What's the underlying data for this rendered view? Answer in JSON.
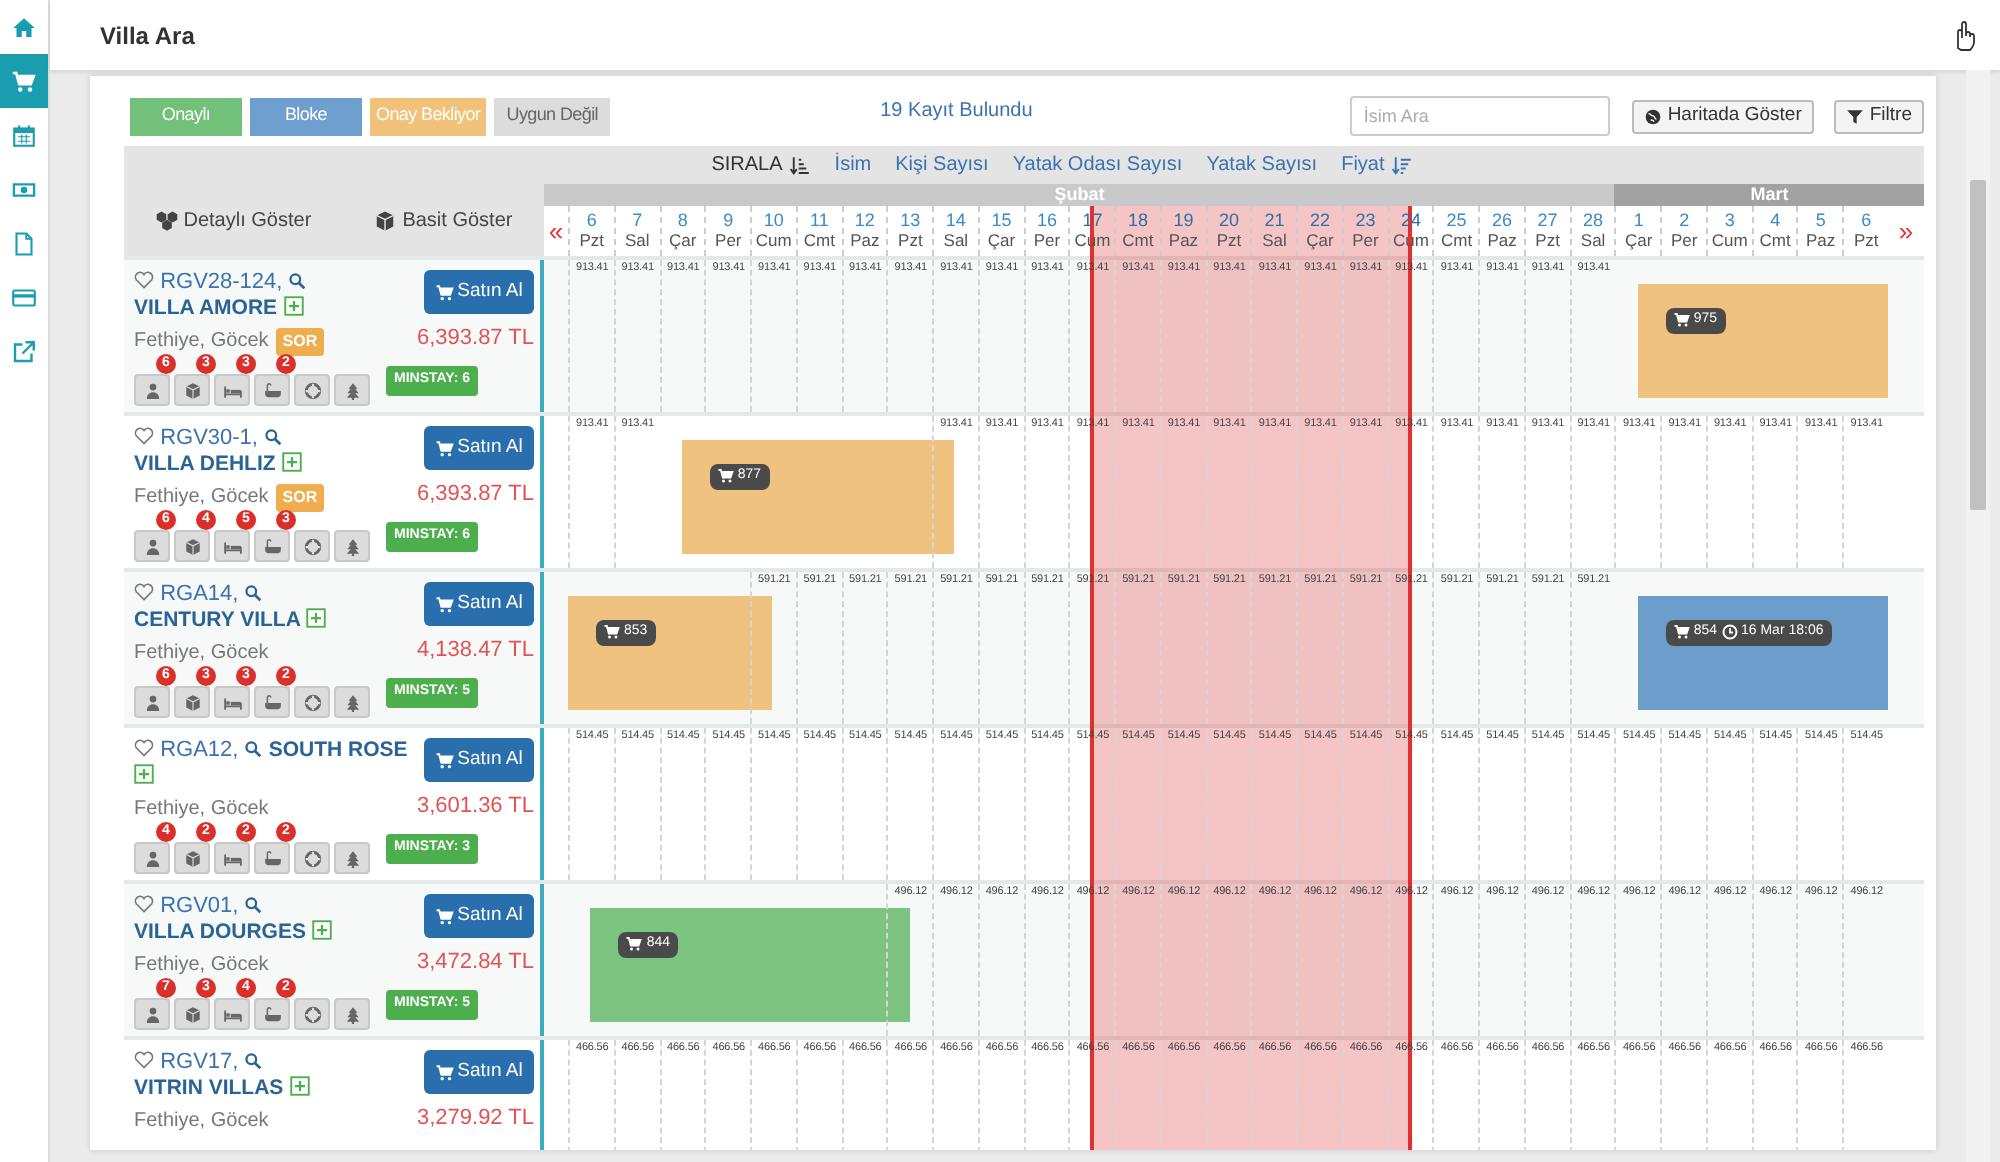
{
  "sidebar": {
    "items": [
      {
        "kind": "home",
        "selected": false
      },
      {
        "kind": "cart",
        "selected": true
      },
      {
        "kind": "calendar",
        "selected": false
      },
      {
        "kind": "money",
        "selected": false
      },
      {
        "kind": "file",
        "selected": false
      },
      {
        "kind": "card",
        "selected": false
      },
      {
        "kind": "external",
        "selected": false
      }
    ]
  },
  "page_title": "Villa Ara",
  "legend": [
    {
      "label": "Onaylı",
      "kind": "confirmed"
    },
    {
      "label": "Bloke",
      "kind": "blocked"
    },
    {
      "label": "Onay Bekliyor",
      "kind": "pending"
    },
    {
      "label": "Uygun Değil",
      "kind": "unavailable"
    }
  ],
  "result_count": "19 Kayıt Bulundu",
  "search": {
    "placeholder": "İsim Ara"
  },
  "buttons": [
    {
      "label": "Haritada Göster",
      "kind": "map"
    },
    {
      "label": "Filtre",
      "kind": "filter"
    }
  ],
  "sort_bar": {
    "label": "SIRALA",
    "options": [
      {
        "label": "İsim",
        "sorted": false
      },
      {
        "label": "Kişi Sayısı",
        "sorted": false
      },
      {
        "label": "Yatak Odası Sayısı",
        "sorted": false
      },
      {
        "label": "Yatak Sayısı",
        "sorted": false
      },
      {
        "label": "Fiyat",
        "sorted": true
      }
    ]
  },
  "view_options": [
    {
      "label": "Detaylı Göster",
      "kind": "detailed"
    },
    {
      "label": "Basit Göster",
      "kind": "simple"
    }
  ],
  "prev_arrow": "«",
  "next_arrow": "»",
  "months": [
    {
      "label": "Şubat",
      "kind": "light",
      "days": [
        {
          "day": "6",
          "weekday": "Pzt",
          "selected": false
        },
        {
          "day": "7",
          "weekday": "Sal",
          "selected": false
        },
        {
          "day": "8",
          "weekday": "Çar",
          "selected": false
        },
        {
          "day": "9",
          "weekday": "Per",
          "selected": false
        },
        {
          "day": "10",
          "weekday": "Cum",
          "selected": false
        },
        {
          "day": "11",
          "weekday": "Cmt",
          "selected": false
        },
        {
          "day": "12",
          "weekday": "Paz",
          "selected": false
        },
        {
          "day": "13",
          "weekday": "Pzt",
          "selected": false
        },
        {
          "day": "14",
          "weekday": "Sal",
          "selected": false
        },
        {
          "day": "15",
          "weekday": "Çar",
          "selected": false
        },
        {
          "day": "16",
          "weekday": "Per",
          "selected": false
        },
        {
          "day": "17",
          "weekday": "Cum",
          "selected": true
        },
        {
          "day": "18",
          "weekday": "Cmt",
          "selected": true
        },
        {
          "day": "19",
          "weekday": "Paz",
          "selected": true
        },
        {
          "day": "20",
          "weekday": "Pzt",
          "selected": true
        },
        {
          "day": "21",
          "weekday": "Sal",
          "selected": true
        },
        {
          "day": "22",
          "weekday": "Çar",
          "selected": true
        },
        {
          "day": "23",
          "weekday": "Per",
          "selected": true
        },
        {
          "day": "24",
          "weekday": "Cum",
          "selected": true
        },
        {
          "day": "25",
          "weekday": "Cmt",
          "selected": false
        },
        {
          "day": "26",
          "weekday": "Paz",
          "selected": false
        },
        {
          "day": "27",
          "weekday": "Pzt",
          "selected": false
        },
        {
          "day": "28",
          "weekday": "Sal",
          "selected": false
        }
      ]
    },
    {
      "label": "Mart",
      "kind": "dark",
      "days": [
        {
          "day": "1",
          "weekday": "Çar",
          "selected": false
        },
        {
          "day": "2",
          "weekday": "Per",
          "selected": false
        },
        {
          "day": "3",
          "weekday": "Cum",
          "selected": false
        },
        {
          "day": "4",
          "weekday": "Cmt",
          "selected": false
        },
        {
          "day": "5",
          "weekday": "Paz",
          "selected": false
        },
        {
          "day": "6",
          "weekday": "Pzt",
          "selected": false
        }
      ]
    }
  ],
  "listings": [
    {
      "favorite": false,
      "code": "RGV28-124,",
      "name": "VILLA AMORE",
      "location": "Fethiye, Göcek",
      "tag": "SOR",
      "buy_label": "Satın Al",
      "price": "6,393.87 TL",
      "features": [
        {
          "kind": "guests",
          "count": "6"
        },
        {
          "kind": "rooms",
          "count": "3"
        },
        {
          "kind": "beds",
          "count": "3"
        },
        {
          "kind": "baths",
          "count": "2"
        },
        {
          "kind": "pool"
        },
        {
          "kind": "garden"
        }
      ],
      "min_stay": "MINSTAY: 6",
      "cells": [
        {
          "kind": "open",
          "price": "913.41"
        },
        {
          "kind": "open",
          "price": "913.41"
        },
        {
          "kind": "open",
          "price": "913.41"
        },
        {
          "kind": "open",
          "price": "913.41"
        },
        {
          "kind": "open",
          "price": "913.41"
        },
        {
          "kind": "open",
          "price": "913.41"
        },
        {
          "kind": "open",
          "price": "913.41"
        },
        {
          "kind": "open",
          "price": "913.41"
        },
        {
          "kind": "open",
          "price": "913.41"
        },
        {
          "kind": "open",
          "price": "913.41"
        },
        {
          "kind": "open",
          "price": "913.41"
        },
        {
          "kind": "open",
          "price": "913.41"
        },
        {
          "kind": "open",
          "price": "913.41"
        },
        {
          "kind": "open",
          "price": "913.41"
        },
        {
          "kind": "open",
          "price": "913.41"
        },
        {
          "kind": "open",
          "price": "913.41"
        },
        {
          "kind": "open",
          "price": "913.41"
        },
        {
          "kind": "open",
          "price": "913.41"
        },
        {
          "kind": "open",
          "price": "913.41"
        },
        {
          "kind": "open",
          "price": "913.41"
        },
        {
          "kind": "open",
          "price": "913.41"
        },
        {
          "kind": "open",
          "price": "913.41"
        },
        {
          "kind": "open",
          "price": "913.41"
        },
        {
          "kind": "check_in"
        },
        {
          "kind": "booked"
        },
        {
          "kind": "booked"
        },
        {
          "kind": "booked"
        },
        {
          "kind": "booked"
        },
        {
          "kind": "booked"
        }
      ],
      "bookings": [
        {
          "kind": "pending",
          "label": "975"
        }
      ]
    },
    {
      "favorite": false,
      "code": "RGV30-1,",
      "name": "VILLA DEHLIZ",
      "location": "Fethiye, Göcek",
      "tag": "SOR",
      "buy_label": "Satın Al",
      "price": "6,393.87 TL",
      "features": [
        {
          "kind": "guests",
          "count": "6"
        },
        {
          "kind": "rooms",
          "count": "4"
        },
        {
          "kind": "beds",
          "count": "5"
        },
        {
          "kind": "baths",
          "count": "3"
        },
        {
          "kind": "pool"
        },
        {
          "kind": "garden"
        }
      ],
      "min_stay": "MINSTAY: 6",
      "cells": [
        {
          "kind": "open",
          "price": "913.41"
        },
        {
          "kind": "open",
          "price": "913.41"
        },
        {
          "kind": "check_in"
        },
        {
          "kind": "booked"
        },
        {
          "kind": "booked"
        },
        {
          "kind": "booked"
        },
        {
          "kind": "booked"
        },
        {
          "kind": "booked"
        },
        {
          "kind": "check_out",
          "price": "913.41"
        },
        {
          "kind": "open",
          "price": "913.41"
        },
        {
          "kind": "open",
          "price": "913.41"
        },
        {
          "kind": "open",
          "price": "913.41"
        },
        {
          "kind": "open",
          "price": "913.41"
        },
        {
          "kind": "open",
          "price": "913.41"
        },
        {
          "kind": "open",
          "price": "913.41"
        },
        {
          "kind": "open",
          "price": "913.41"
        },
        {
          "kind": "open",
          "price": "913.41"
        },
        {
          "kind": "open",
          "price": "913.41"
        },
        {
          "kind": "open",
          "price": "913.41"
        },
        {
          "kind": "open",
          "price": "913.41"
        },
        {
          "kind": "open",
          "price": "913.41"
        },
        {
          "kind": "open",
          "price": "913.41"
        },
        {
          "kind": "open",
          "price": "913.41"
        },
        {
          "kind": "open",
          "price": "913.41"
        },
        {
          "kind": "open",
          "price": "913.41"
        },
        {
          "kind": "open",
          "price": "913.41"
        },
        {
          "kind": "open",
          "price": "913.41"
        },
        {
          "kind": "open",
          "price": "913.41"
        },
        {
          "kind": "open",
          "price": "913.41"
        }
      ],
      "bookings": [
        {
          "kind": "pending",
          "label": "877"
        }
      ]
    },
    {
      "favorite": false,
      "code": "RGA14,",
      "name": "CENTURY VILLA",
      "location": "Fethiye, Göcek",
      "buy_label": "Satın Al",
      "price": "4,138.47 TL",
      "features": [
        {
          "kind": "guests",
          "count": "6"
        },
        {
          "kind": "rooms",
          "count": "3"
        },
        {
          "kind": "beds",
          "count": "3"
        },
        {
          "kind": "baths",
          "count": "2"
        },
        {
          "kind": "pool"
        },
        {
          "kind": "garden"
        }
      ],
      "min_stay": "MINSTAY: 5",
      "cells": [
        {
          "kind": "booked"
        },
        {
          "kind": "booked"
        },
        {
          "kind": "booked"
        },
        {
          "kind": "booked"
        },
        {
          "kind": "check_out",
          "price": "591.21"
        },
        {
          "kind": "open",
          "price": "591.21"
        },
        {
          "kind": "open",
          "price": "591.21"
        },
        {
          "kind": "open",
          "price": "591.21"
        },
        {
          "kind": "open",
          "price": "591.21"
        },
        {
          "kind": "open",
          "price": "591.21"
        },
        {
          "kind": "open",
          "price": "591.21"
        },
        {
          "kind": "open",
          "price": "591.21"
        },
        {
          "kind": "open",
          "price": "591.21"
        },
        {
          "kind": "open",
          "price": "591.21"
        },
        {
          "kind": "open",
          "price": "591.21"
        },
        {
          "kind": "open",
          "price": "591.21"
        },
        {
          "kind": "open",
          "price": "591.21"
        },
        {
          "kind": "open",
          "price": "591.21"
        },
        {
          "kind": "open",
          "price": "591.21"
        },
        {
          "kind": "open",
          "price": "591.21"
        },
        {
          "kind": "open",
          "price": "591.21"
        },
        {
          "kind": "open",
          "price": "591.21"
        },
        {
          "kind": "open",
          "price": "591.21"
        },
        {
          "kind": "check_in"
        },
        {
          "kind": "booked"
        },
        {
          "kind": "booked"
        },
        {
          "kind": "booked"
        },
        {
          "kind": "booked"
        },
        {
          "kind": "booked"
        }
      ],
      "bookings": [
        {
          "kind": "pending",
          "label": "853"
        },
        {
          "kind": "blocked",
          "label": "854",
          "time": "16 Mar 18:06"
        }
      ]
    },
    {
      "favorite": false,
      "code": "RGA12,",
      "name": "SOUTH ROSE",
      "location": "Fethiye, Göcek",
      "buy_label": "Satın Al",
      "price": "3,601.36 TL",
      "features": [
        {
          "kind": "guests",
          "count": "4"
        },
        {
          "kind": "rooms",
          "count": "2"
        },
        {
          "kind": "beds",
          "count": "2"
        },
        {
          "kind": "baths",
          "count": "2"
        },
        {
          "kind": "pool"
        },
        {
          "kind": "garden"
        }
      ],
      "min_stay": "MINSTAY: 3",
      "cells": [
        {
          "kind": "open",
          "price": "514.45"
        },
        {
          "kind": "open",
          "price": "514.45"
        },
        {
          "kind": "open",
          "price": "514.45"
        },
        {
          "kind": "open",
          "price": "514.45"
        },
        {
          "kind": "open",
          "price": "514.45"
        },
        {
          "kind": "open",
          "price": "514.45"
        },
        {
          "kind": "open",
          "price": "514.45"
        },
        {
          "kind": "open",
          "price": "514.45"
        },
        {
          "kind": "open",
          "price": "514.45"
        },
        {
          "kind": "open",
          "price": "514.45"
        },
        {
          "kind": "open",
          "price": "514.45"
        },
        {
          "kind": "open",
          "price": "514.45"
        },
        {
          "kind": "open",
          "price": "514.45"
        },
        {
          "kind": "open",
          "price": "514.45"
        },
        {
          "kind": "open",
          "price": "514.45"
        },
        {
          "kind": "open",
          "price": "514.45"
        },
        {
          "kind": "open",
          "price": "514.45"
        },
        {
          "kind": "open",
          "price": "514.45"
        },
        {
          "kind": "open",
          "price": "514.45"
        },
        {
          "kind": "open",
          "price": "514.45"
        },
        {
          "kind": "open",
          "price": "514.45"
        },
        {
          "kind": "open",
          "price": "514.45"
        },
        {
          "kind": "open",
          "price": "514.45"
        },
        {
          "kind": "open",
          "price": "514.45"
        },
        {
          "kind": "open",
          "price": "514.45"
        },
        {
          "kind": "open",
          "price": "514.45"
        },
        {
          "kind": "open",
          "price": "514.45"
        },
        {
          "kind": "open",
          "price": "514.45"
        },
        {
          "kind": "open",
          "price": "514.45"
        }
      ]
    },
    {
      "favorite": false,
      "code": "RGV01,",
      "name": "VILLA DOURGES",
      "location": "Fethiye, Göcek",
      "buy_label": "Satın Al",
      "price": "3,472.84 TL",
      "features": [
        {
          "kind": "guests",
          "count": "7"
        },
        {
          "kind": "rooms",
          "count": "3"
        },
        {
          "kind": "beds",
          "count": "4"
        },
        {
          "kind": "baths",
          "count": "2"
        },
        {
          "kind": "pool"
        },
        {
          "kind": "garden"
        }
      ],
      "min_stay": "MINSTAY: 5",
      "cells": [
        {
          "kind": "check_in"
        },
        {
          "kind": "booked"
        },
        {
          "kind": "booked"
        },
        {
          "kind": "booked"
        },
        {
          "kind": "booked"
        },
        {
          "kind": "booked"
        },
        {
          "kind": "booked"
        },
        {
          "kind": "check_out",
          "price": "496.12"
        },
        {
          "kind": "open",
          "price": "496.12"
        },
        {
          "kind": "open",
          "price": "496.12"
        },
        {
          "kind": "open",
          "price": "496.12"
        },
        {
          "kind": "open",
          "price": "496.12"
        },
        {
          "kind": "open",
          "price": "496.12"
        },
        {
          "kind": "open",
          "price": "496.12"
        },
        {
          "kind": "open",
          "price": "496.12"
        },
        {
          "kind": "open",
          "price": "496.12"
        },
        {
          "kind": "open",
          "price": "496.12"
        },
        {
          "kind": "open",
          "price": "496.12"
        },
        {
          "kind": "open",
          "price": "496.12"
        },
        {
          "kind": "open",
          "price": "496.12"
        },
        {
          "kind": "open",
          "price": "496.12"
        },
        {
          "kind": "open",
          "price": "496.12"
        },
        {
          "kind": "open",
          "price": "496.12"
        },
        {
          "kind": "open",
          "price": "496.12"
        },
        {
          "kind": "open",
          "price": "496.12"
        },
        {
          "kind": "open",
          "price": "496.12"
        },
        {
          "kind": "open",
          "price": "496.12"
        },
        {
          "kind": "open",
          "price": "496.12"
        },
        {
          "kind": "open",
          "price": "496.12"
        }
      ],
      "bookings": [
        {
          "kind": "confirmed",
          "label": "844"
        }
      ]
    },
    {
      "favorite": false,
      "code": "RGV17,",
      "name": "VITRIN VILLAS",
      "location": "Fethiye, Göcek",
      "buy_label": "Satın Al",
      "price": "3,279.92 TL",
      "cells": [
        {
          "kind": "open",
          "price": "466.56"
        },
        {
          "kind": "open",
          "price": "466.56"
        },
        {
          "kind": "open",
          "price": "466.56"
        },
        {
          "kind": "open",
          "price": "466.56"
        },
        {
          "kind": "open",
          "price": "466.56"
        },
        {
          "kind": "open",
          "price": "466.56"
        },
        {
          "kind": "open",
          "price": "466.56"
        },
        {
          "kind": "open",
          "price": "466.56"
        },
        {
          "kind": "open",
          "price": "466.56"
        },
        {
          "kind": "open",
          "price": "466.56"
        },
        {
          "kind": "open",
          "price": "466.56"
        },
        {
          "kind": "open",
          "price": "466.56"
        },
        {
          "kind": "open",
          "price": "466.56"
        },
        {
          "kind": "open",
          "price": "466.56"
        },
        {
          "kind": "open",
          "price": "466.56"
        },
        {
          "kind": "open",
          "price": "466.56"
        },
        {
          "kind": "open",
          "price": "466.56"
        },
        {
          "kind": "open",
          "price": "466.56"
        },
        {
          "kind": "open",
          "price": "466.56"
        },
        {
          "kind": "open",
          "price": "466.56"
        },
        {
          "kind": "open",
          "price": "466.56"
        },
        {
          "kind": "open",
          "price": "466.56"
        },
        {
          "kind": "open",
          "price": "466.56"
        },
        {
          "kind": "open",
          "price": "466.56"
        },
        {
          "kind": "open",
          "price": "466.56"
        },
        {
          "kind": "open",
          "price": "466.56"
        },
        {
          "kind": "open",
          "price": "466.56"
        },
        {
          "kind": "open",
          "price": "466.56"
        },
        {
          "kind": "open",
          "price": "466.56"
        }
      ]
    }
  ]
}
